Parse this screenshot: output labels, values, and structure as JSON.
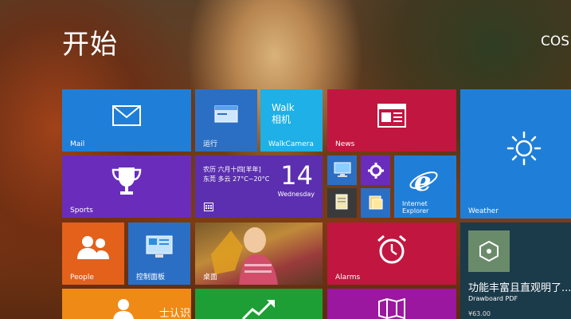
{
  "header": {
    "title": "开始",
    "user": "COS"
  },
  "colors": {
    "blue": "#1f7fd8",
    "red": "#c1163f",
    "purple": "#6a2dbb",
    "cyan": "#1eb0e6",
    "orange": "#e3611b",
    "green": "#1e9f35",
    "magenta": "#9b179f"
  },
  "tiles": {
    "mail": {
      "label": "Mail",
      "icon": "mail-icon"
    },
    "run": {
      "label": "运行",
      "icon": "run-icon"
    },
    "walkcamera": {
      "label": "WalkCamera",
      "title_line1": "Walk",
      "title_line2": "相机"
    },
    "news": {
      "label": "News",
      "icon": "news-icon"
    },
    "weather": {
      "label": "Weather",
      "icon": "sun-icon"
    },
    "sports": {
      "label": "Sports",
      "icon": "trophy-icon"
    },
    "calendar": {
      "line1": "农历 六月十四[羊年]",
      "line2": "东莞 多云 27°C~20°C",
      "day": "14",
      "weekday": "Wednesday",
      "icon": "calendar-icon"
    },
    "ie": {
      "label_line1": "Internet",
      "label_line2": "Explorer",
      "icon": "ie-icon"
    },
    "people": {
      "label": "People",
      "icon": "people-icon"
    },
    "control_panel": {
      "label": "控制面板",
      "icon": "control-panel-icon"
    },
    "desktop": {
      "label": "桌面"
    },
    "alarms": {
      "label": "Alarms",
      "icon": "alarm-clock-icon"
    },
    "drawboard": {
      "text": "功能丰富且直观明了...",
      "sub": "Drawboard PDF",
      "price": "¥63.00",
      "icon": "drawboard-icon"
    },
    "partial": {
      "text": "士认识"
    }
  }
}
